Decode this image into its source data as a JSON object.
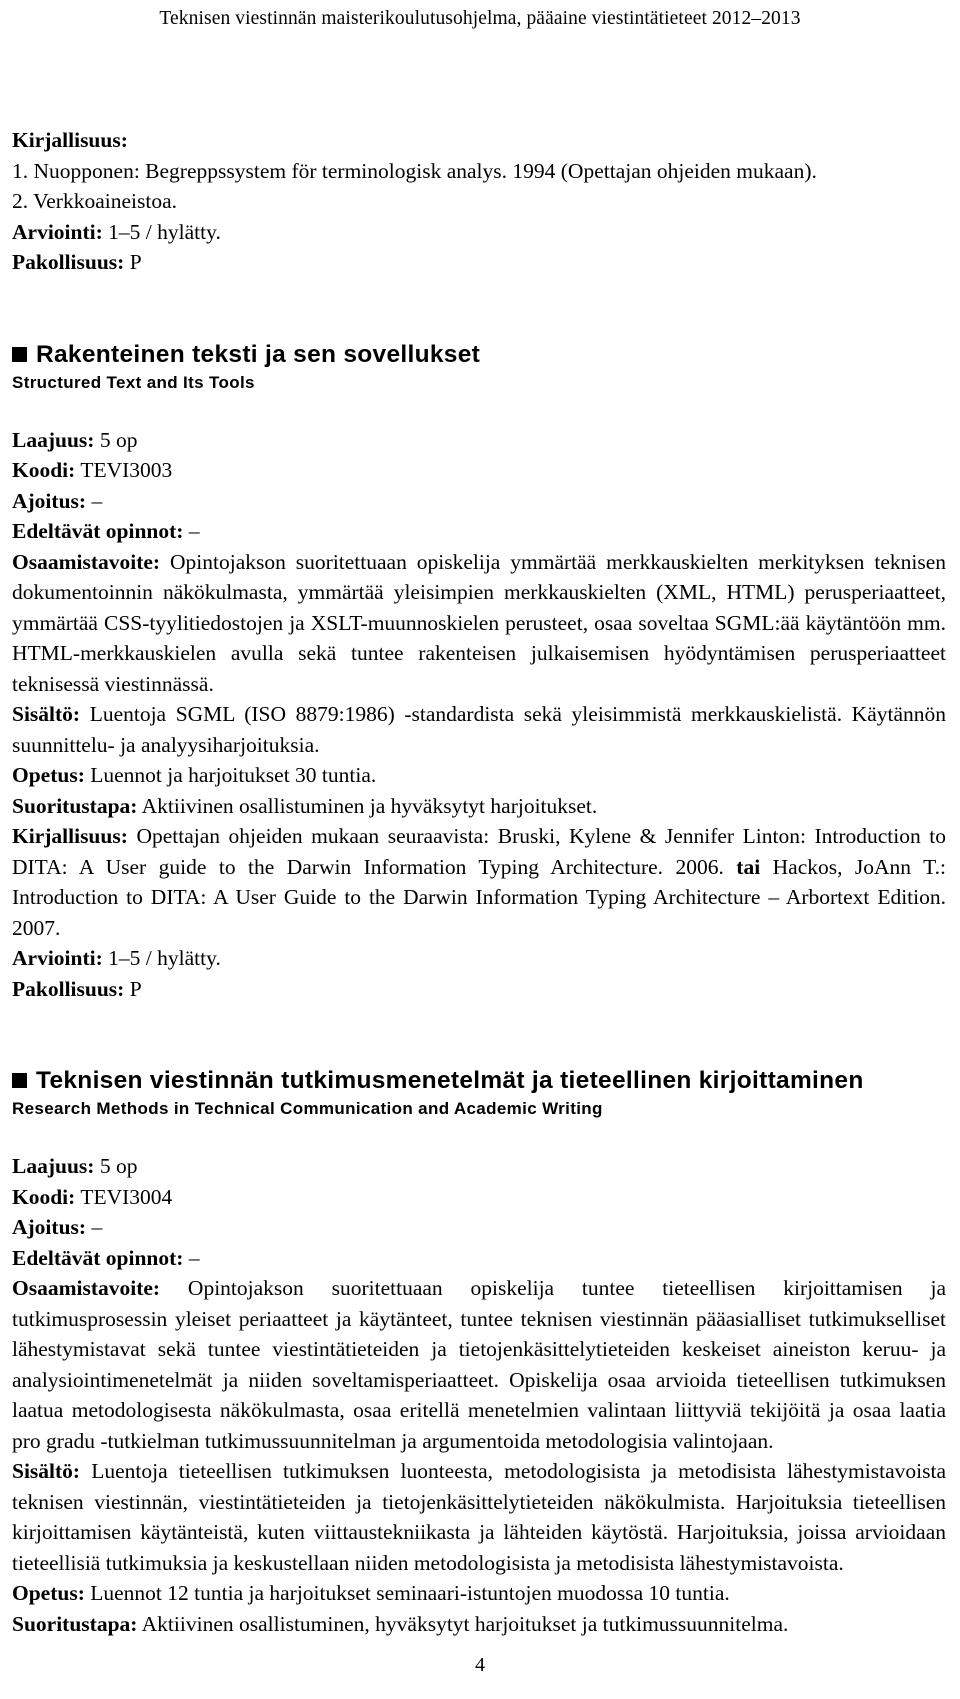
{
  "header": {
    "running_title": "Teknisen viestinnän maisterikoulutusohjelma, pääaine viestintätieteet 2012–2013"
  },
  "top_block": {
    "literature_label": "Kirjallisuus:",
    "literature_items": [
      "1. Nuopponen: Begreppssystem för terminologisk analys. 1994 (Opettajan ohjeiden mukaan).",
      "2. Verkkoaineistoa."
    ],
    "grading_label": "Arviointi:",
    "grading_value": "1–5 / hylätty.",
    "compulsory_label": "Pakollisuus:",
    "compulsory_value": "P"
  },
  "courses": [
    {
      "title_fi": "Rakenteinen teksti ja sen sovellukset",
      "title_en": "Structured Text and Its Tools",
      "scope_label": "Laajuus:",
      "scope_value": "5 op",
      "code_label": "Koodi:",
      "code_value": "TEVI3003",
      "timing_label": "Ajoitus:",
      "timing_value": "–",
      "prereq_label": "Edeltävät opinnot:",
      "prereq_value": "–",
      "objective_label": "Osaamistavoite:",
      "objective_text": "Opintojakson suoritettuaan opiskelija ymmärtää merkkauskielten merkityksen teknisen dokumentoinnin näkökulmasta, ymmärtää yleisimpien merkkauskielten (XML, HTML) perusperiaatteet, ymmärtää CSS-tyylitiedostojen ja XSLT-muunnoskielen perusteet, osaa soveltaa SGML:ää käytäntöön mm. HTML-merkkauskielen avulla sekä tuntee rakenteisen julkaisemisen hyödyntämisen perusperiaatteet teknisessä viestinnässä.",
      "content_label": "Sisältö:",
      "content_text": "Luentoja SGML (ISO 8879:1986) -standardista sekä yleisimmistä merkkauskielistä. Käytännön suunnittelu- ja analyysiharjoituksia.",
      "teaching_label": "Opetus:",
      "teaching_text": "Luennot ja harjoitukset 30 tuntia.",
      "completion_label": "Suoritustapa:",
      "completion_text": "Aktiivinen osallistuminen ja hyväksytyt harjoitukset.",
      "literature_label": "Kirjallisuus:",
      "literature_text_1": "Opettajan ohjeiden mukaan seuraavista: Bruski, Kylene & Jennifer Linton: Introduction to DITA: A User guide to the Darwin Information Typing Architecture. 2006. ",
      "literature_or": "tai",
      "literature_text_2": " Hackos, JoAnn T.: Introduction to DITA: A User Guide to the Darwin Information Typing Architecture – Arbortext Edition. 2007.",
      "grading_label": "Arviointi:",
      "grading_value": "1–5 / hylätty.",
      "compulsory_label": "Pakollisuus:",
      "compulsory_value": "P"
    },
    {
      "title_fi": "Teknisen viestinnän tutkimusmenetelmät ja tieteellinen kirjoittaminen",
      "title_en": "Research Methods in Technical Communication and Academic Writing",
      "scope_label": "Laajuus:",
      "scope_value": "5 op",
      "code_label": "Koodi:",
      "code_value": "TEVI3004",
      "timing_label": "Ajoitus:",
      "timing_value": "–",
      "prereq_label": "Edeltävät opinnot:",
      "prereq_value": "–",
      "objective_label": "Osaamistavoite:",
      "objective_text": "Opintojakson suoritettuaan opiskelija tuntee tieteellisen kirjoittamisen ja tutkimusprosessin yleiset periaatteet ja käytänteet, tuntee teknisen viestinnän pääasialliset tutkimukselliset lähestymistavat sekä tuntee viestintätieteiden ja tietojenkäsittelytieteiden keskeiset aineiston keruu- ja analysiointimenetelmät ja niiden soveltamisperiaatteet. Opiskelija osaa arvioida tieteellisen tutkimuksen laatua metodologisesta näkökulmasta, osaa eritellä menetelmien valintaan liittyviä tekijöitä ja osaa laatia pro gradu -tutkielman tutkimussuunnitelman ja argumentoida metodologisia valintojaan.",
      "content_label": "Sisältö:",
      "content_text": "Luentoja tieteellisen tutkimuksen luonteesta, metodologisista ja metodisista lähestymistavoista teknisen viestinnän, viestintätieteiden ja tietojenkäsittelytieteiden näkökulmista. Harjoituksia tieteellisen kirjoittamisen käytänteistä, kuten viittaustekniikasta ja lähteiden käytöstä. Harjoituksia, joissa arvioidaan tieteellisiä tutkimuksia ja keskustellaan niiden metodologisista ja metodisista lähestymistavoista.",
      "teaching_label": "Opetus:",
      "teaching_text": "Luennot 12 tuntia ja harjoitukset seminaari-istuntojen muodossa 10 tuntia.",
      "completion_label": "Suoritustapa:",
      "completion_text": "Aktiivinen osallistuminen, hyväksytyt harjoitukset ja tutkimussuunnitelma."
    }
  ],
  "footer": {
    "page_number": "4"
  }
}
